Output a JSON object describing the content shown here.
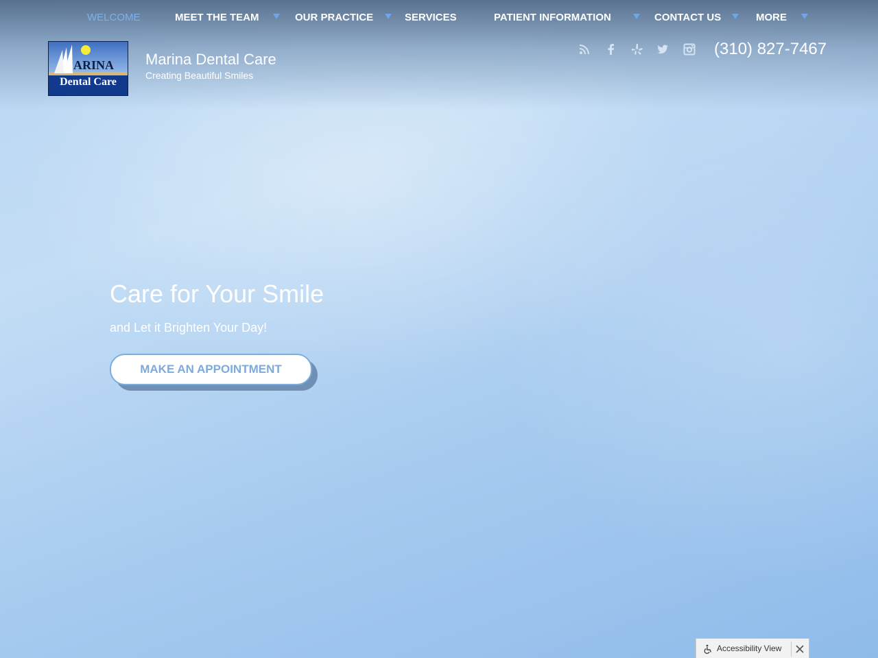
{
  "nav": {
    "items": [
      {
        "label": "WELCOME",
        "active": true
      },
      {
        "label": "MEET THE TEAM",
        "dropdown": true
      },
      {
        "label": "OUR PRACTICE",
        "dropdown": true
      },
      {
        "label": "SERVICES",
        "dropdown": false
      },
      {
        "label": "PATIENT INFORMATION",
        "dropdown": true
      },
      {
        "label": "CONTACT US",
        "dropdown": true
      },
      {
        "label": "MORE",
        "dropdown": true
      }
    ]
  },
  "brand": {
    "logo_text_top": "ARINA",
    "logo_text_bottom": "Dental Care",
    "site_name": "Marina Dental Care",
    "tagline": "Creating Beautiful Smiles"
  },
  "social": {
    "icons": [
      "rss-icon",
      "facebook-icon",
      "yelp-icon",
      "twitter-icon",
      "instagram-icon"
    ],
    "phone": "(310) 827-7467"
  },
  "hero": {
    "title": "Care for Your Smile",
    "subtitle": "and Let it Brighten Your Day!",
    "cta_label": "MAKE AN APPOINTMENT"
  },
  "accessibility": {
    "label": "Accessibility View"
  },
  "colors": {
    "accent": "#7fb0e8",
    "caret": "#6fa6e6",
    "cta_text": "#7da9dd"
  }
}
